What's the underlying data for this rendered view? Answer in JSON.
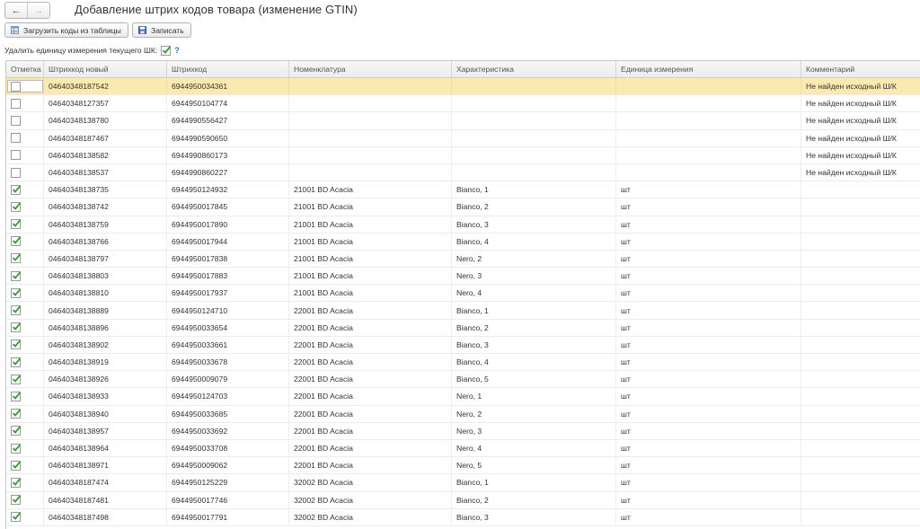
{
  "nav": {
    "back_icon": "arrow-left-icon",
    "forward_icon": "arrow-right-icon"
  },
  "title": "Добавление штрих кодов товара (изменение GTIN)",
  "toolbar": {
    "load_label": "Загрузить коды из таблицы",
    "save_label": "Записать"
  },
  "option": {
    "label": "Удалить единицу измерения текущего ШК:",
    "checked": true,
    "help": "?"
  },
  "colors": {
    "selected_row": "#fbeab0",
    "check": "#3a9a3a"
  },
  "table": {
    "columns": [
      "Отметка",
      "Штрихкод новый",
      "Штрихкод",
      "Номенклатура",
      "Характеристика",
      "Единица измерения",
      "Комментарий"
    ],
    "rows": [
      {
        "checked": false,
        "new": "04640348187542",
        "code": "6944950034361",
        "item": "",
        "char": "",
        "unit": "",
        "comment": "Не найден исходный Ш/К"
      },
      {
        "checked": false,
        "new": "04640348127357",
        "code": "6944950104774",
        "item": "",
        "char": "",
        "unit": "",
        "comment": "Не найден исходный Ш/К"
      },
      {
        "checked": false,
        "new": "04640348138780",
        "code": "6944990556427",
        "item": "",
        "char": "",
        "unit": "",
        "comment": "Не найден исходный Ш/К"
      },
      {
        "checked": false,
        "new": "04640348187467",
        "code": "6944990590650",
        "item": "",
        "char": "",
        "unit": "",
        "comment": "Не найден исходный Ш/К"
      },
      {
        "checked": false,
        "new": "04640348138582",
        "code": "6944990860173",
        "item": "",
        "char": "",
        "unit": "",
        "comment": "Не найден исходный Ш/К"
      },
      {
        "checked": false,
        "new": "04640348138537",
        "code": "6944990860227",
        "item": "",
        "char": "",
        "unit": "",
        "comment": "Не найден исходный Ш/К"
      },
      {
        "checked": true,
        "new": "04640348138735",
        "code": "6944950124932",
        "item": "21001 BD  Acacia",
        "char": "Bianco, 1",
        "unit": "шт",
        "comment": ""
      },
      {
        "checked": true,
        "new": "04640348138742",
        "code": "6944950017845",
        "item": "21001 BD  Acacia",
        "char": "Bianco, 2",
        "unit": "шт",
        "comment": ""
      },
      {
        "checked": true,
        "new": "04640348138759",
        "code": "6944950017890",
        "item": "21001 BD  Acacia",
        "char": "Bianco, 3",
        "unit": "шт",
        "comment": ""
      },
      {
        "checked": true,
        "new": "04640348138766",
        "code": "6944950017944",
        "item": "21001 BD  Acacia",
        "char": "Bianco, 4",
        "unit": "шт",
        "comment": ""
      },
      {
        "checked": true,
        "new": "04640348138797",
        "code": "6944950017838",
        "item": "21001 BD  Acacia",
        "char": "Nero, 2",
        "unit": "шт",
        "comment": ""
      },
      {
        "checked": true,
        "new": "04640348138803",
        "code": "6944950017883",
        "item": "21001 BD  Acacia",
        "char": "Nero, 3",
        "unit": "шт",
        "comment": ""
      },
      {
        "checked": true,
        "new": "04640348138810",
        "code": "6944950017937",
        "item": "21001 BD  Acacia",
        "char": "Nero, 4",
        "unit": "шт",
        "comment": ""
      },
      {
        "checked": true,
        "new": "04640348138889",
        "code": "6944950124710",
        "item": "22001 BD Acacia",
        "char": "Bianco, 1",
        "unit": "шт",
        "comment": ""
      },
      {
        "checked": true,
        "new": "04640348138896",
        "code": "6944950033654",
        "item": "22001 BD Acacia",
        "char": "Bianco, 2",
        "unit": "шт",
        "comment": ""
      },
      {
        "checked": true,
        "new": "04640348138902",
        "code": "6944950033661",
        "item": "22001 BD Acacia",
        "char": "Bianco, 3",
        "unit": "шт",
        "comment": ""
      },
      {
        "checked": true,
        "new": "04640348138919",
        "code": "6944950033678",
        "item": "22001 BD Acacia",
        "char": "Bianco, 4",
        "unit": "шт",
        "comment": ""
      },
      {
        "checked": true,
        "new": "04640348138926",
        "code": "6944950009079",
        "item": "22001 BD Acacia",
        "char": "Bianco, 5",
        "unit": "шт",
        "comment": ""
      },
      {
        "checked": true,
        "new": "04640348138933",
        "code": "6944950124703",
        "item": "22001 BD Acacia",
        "char": "Nero, 1",
        "unit": "шт",
        "comment": ""
      },
      {
        "checked": true,
        "new": "04640348138940",
        "code": "6944950033685",
        "item": "22001 BD Acacia",
        "char": "Nero, 2",
        "unit": "шт",
        "comment": ""
      },
      {
        "checked": true,
        "new": "04640348138957",
        "code": "6944950033692",
        "item": "22001 BD Acacia",
        "char": "Nero, 3",
        "unit": "шт",
        "comment": ""
      },
      {
        "checked": true,
        "new": "04640348138964",
        "code": "6944950033708",
        "item": "22001 BD Acacia",
        "char": "Nero, 4",
        "unit": "шт",
        "comment": ""
      },
      {
        "checked": true,
        "new": "04640348138971",
        "code": "6944950009062",
        "item": "22001 BD Acacia",
        "char": "Nero, 5",
        "unit": "шт",
        "comment": ""
      },
      {
        "checked": true,
        "new": "04640348187474",
        "code": "6944950125229",
        "item": "32002 BD Acacia",
        "char": "Bianco, 1",
        "unit": "шт",
        "comment": ""
      },
      {
        "checked": true,
        "new": "04640348187481",
        "code": "6944950017746",
        "item": "32002 BD Acacia",
        "char": "Bianco, 2",
        "unit": "шт",
        "comment": ""
      },
      {
        "checked": true,
        "new": "04640348187498",
        "code": "6944950017791",
        "item": "32002 BD Acacia",
        "char": "Bianco, 3",
        "unit": "шт",
        "comment": ""
      }
    ]
  }
}
